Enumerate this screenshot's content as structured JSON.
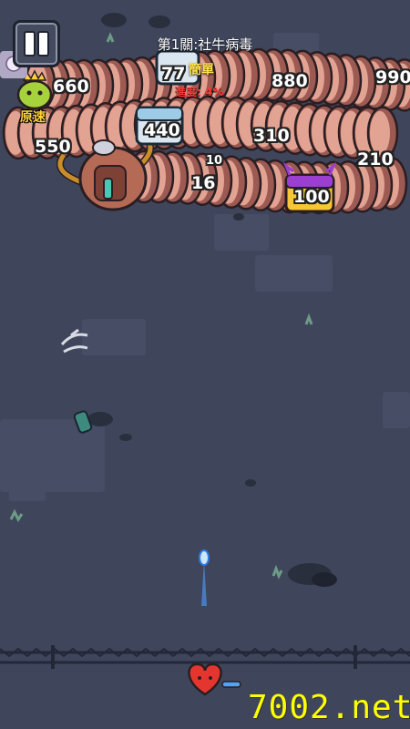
{
  "hud": {
    "level_title": "第1關:社牛病毒",
    "difficulty": "簡單",
    "progress_text": "進度: 4%",
    "speed_label": "原速"
  },
  "worm_segments": [
    {
      "value": "660"
    },
    {
      "value": "77"
    },
    {
      "value": "880"
    },
    {
      "value": "990"
    },
    {
      "value": "440"
    },
    {
      "value": "310"
    },
    {
      "value": "550"
    },
    {
      "value": "210"
    },
    {
      "value": "16"
    },
    {
      "value": "100"
    }
  ],
  "damage_popup": "10",
  "watermark": "7002.net",
  "colors": {
    "background": "#3f465c",
    "segment_body": "#e2a393",
    "segment_dark": "#9c5a52",
    "outline": "#2a1e22",
    "difficulty": "#ffe04a",
    "progress": "#ff3b3b",
    "watermark": "#ffff00"
  },
  "icons": [
    "pause-icon",
    "boss-head-icon",
    "silver-chest-icon",
    "gold-chest-icon",
    "heart-player-icon",
    "bullet-icon",
    "speed-toggle-icon"
  ]
}
